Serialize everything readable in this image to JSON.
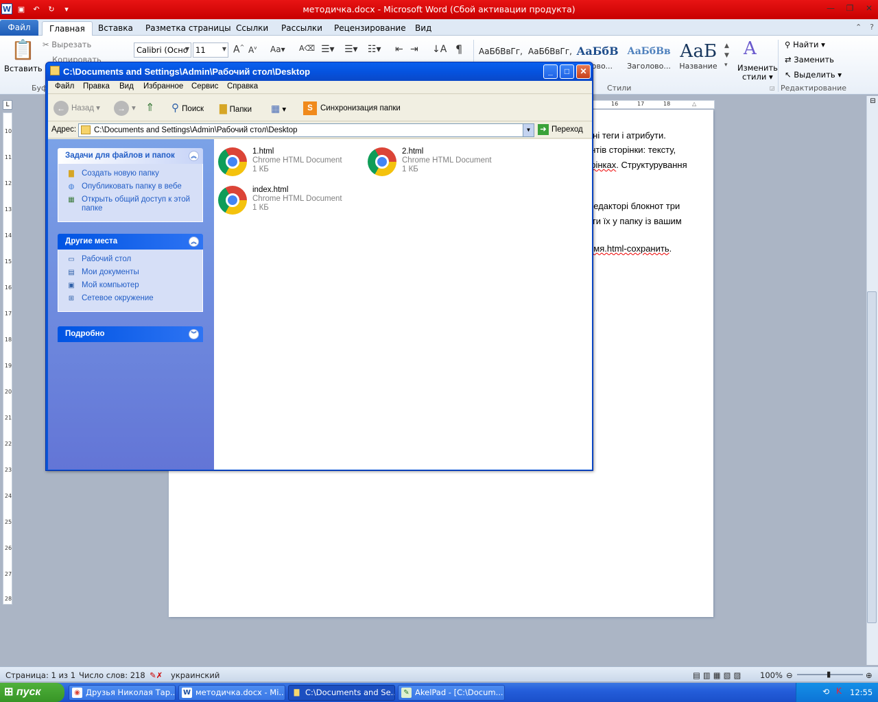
{
  "word": {
    "title": "методичка.docx  -  Microsoft Word (Сбой активации продукта)",
    "tabs": [
      "Файл",
      "Главная",
      "Вставка",
      "Разметка страницы",
      "Ссылки",
      "Рассылки",
      "Рецензирование",
      "Вид"
    ],
    "ribbon": {
      "paste_label": "Вставить",
      "cut_label": "Вырезать",
      "copy_label": "Копировать",
      "clipboard_group": "Буф",
      "font_name": "Calibri (Осно",
      "font_size": "11",
      "pilcrow": "¶",
      "styles": [
        {
          "sample": "АаБбВвГг,",
          "label": ""
        },
        {
          "sample": "АаБбВвГг,",
          "label": ""
        },
        {
          "sample": "АаБбВ",
          "label": "оловo..."
        },
        {
          "sample": "АаБбВв",
          "label": "Заголово..."
        },
        {
          "sample": "АаБ",
          "label": "Название"
        }
      ],
      "change_styles_line1": "Изменить",
      "change_styles_line2": "стили",
      "styles_group": "Стили",
      "find_label": "Найти",
      "replace_label": "Заменить",
      "select_label": "Выделить",
      "editing_group": "Редактирование"
    },
    "hruler_labels": [
      "16",
      "17",
      "18"
    ],
    "vruler_labels": [
      "10",
      "11",
      "12",
      "13",
      "14",
      "15",
      "16",
      "17",
      "18",
      "19",
      "20",
      "21",
      "22",
      "23",
      "24",
      "25",
      "26",
      "27",
      "28"
    ],
    "document_lines": [
      "овні теги і атрибути.",
      "ентів сторінки: тексту,",
      "орінках",
      ". Структурування",
      "редакторі блокнот три",
      "гти їх у папку із вашим",
      "имя.html-сохранить",
      "."
    ],
    "status": {
      "page": "Страница: 1 из 1",
      "words": "Число слов: 218",
      "language": "украинский",
      "zoom": "100%"
    }
  },
  "explorer": {
    "title": "C:\\Documents and Settings\\Admin\\Рабочий стол\\Desktop",
    "menu": [
      "Файл",
      "Правка",
      "Вид",
      "Избранное",
      "Сервис",
      "Справка"
    ],
    "toolbar": {
      "back": "Назад",
      "search": "Поиск",
      "folders": "Папки",
      "sync": "Синхронизация папки"
    },
    "address_label": "Адрес:",
    "address_value": "C:\\Documents and Settings\\Admin\\Рабочий стол\\Desktop",
    "go_label": "Переход",
    "panels": {
      "tasks": {
        "title": "Задачи для файлов и папок",
        "items": [
          "Создать новую папку",
          "Опубликовать папку в вебе",
          "Открыть общий доступ к этой папке"
        ]
      },
      "places": {
        "title": "Другие места",
        "items": [
          "Рабочий стол",
          "Мои документы",
          "Мой компьютер",
          "Сетевое окружение"
        ]
      },
      "details": {
        "title": "Подробно"
      }
    },
    "files": [
      {
        "name": "1.html",
        "type": "Chrome HTML Document",
        "size": "1 КБ"
      },
      {
        "name": "2.html",
        "type": "Chrome HTML Document",
        "size": "1 КБ"
      },
      {
        "name": "index.html",
        "type": "Chrome HTML Document",
        "size": "1 КБ"
      }
    ]
  },
  "taskbar": {
    "start": "пуск",
    "tasks": [
      "Друзья Николая Тар...",
      "методичка.docx - Mi...",
      "C:\\Documents and Se...",
      "AkelPad - [C:\\Docum..."
    ],
    "lang": "EN",
    "time": "12:55"
  },
  "colors": {
    "word_title_bar": "#d40000",
    "xp_title_bar": "#0553df",
    "xp_taskbar": "#245edb",
    "start_button": "#379526",
    "link_blue": "#215dc6"
  }
}
